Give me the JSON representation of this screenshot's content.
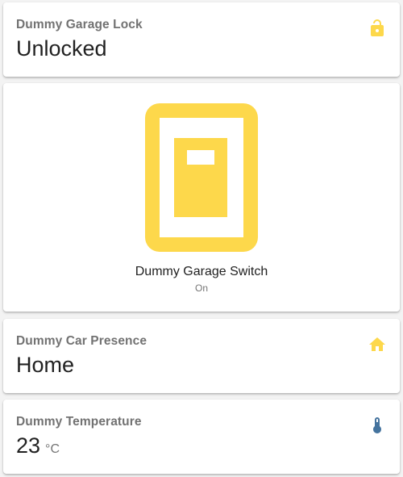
{
  "colors": {
    "accent_yellow": "#FDD84B",
    "thermometer_blue": "#44739E"
  },
  "lock_card": {
    "name": "Dummy Garage Lock",
    "state": "Unlocked",
    "icon": "lock-open-icon"
  },
  "switch_card": {
    "name": "Dummy Garage Switch",
    "state": "On",
    "icon": "garage-switch-icon"
  },
  "presence_card": {
    "name": "Dummy Car Presence",
    "state": "Home",
    "icon": "home-icon"
  },
  "temperature_card": {
    "name": "Dummy Temperature",
    "value": "23",
    "unit": "°C",
    "icon": "thermometer-icon"
  }
}
